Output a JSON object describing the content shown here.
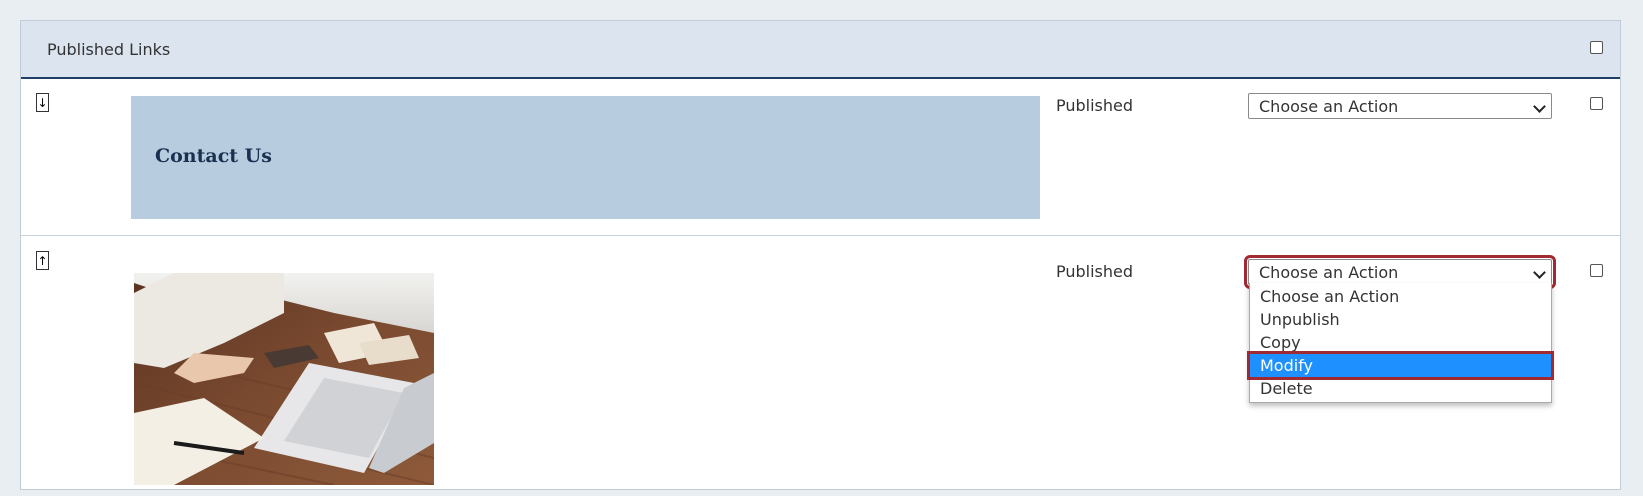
{
  "panel": {
    "title": "Published Links"
  },
  "rows": [
    {
      "move_icon": "arrow-down-icon",
      "banner_text": "Contact Us",
      "status": "Published",
      "action_select": {
        "value": "Choose an Action"
      }
    },
    {
      "move_icon": "arrow-up-icon",
      "status": "Published",
      "action_select": {
        "value": "Choose an Action"
      },
      "dropdown_options": [
        "Choose an Action",
        "Unpublish",
        "Copy",
        "Modify",
        "Delete"
      ],
      "highlighted_option": "Modify"
    }
  ],
  "colors": {
    "header_bg": "#dbe4ef",
    "banner_bg": "#b7cddf",
    "banner_text": "#1a3050",
    "highlight_outline": "#a12a32",
    "option_selected_bg": "#1e90ff"
  }
}
